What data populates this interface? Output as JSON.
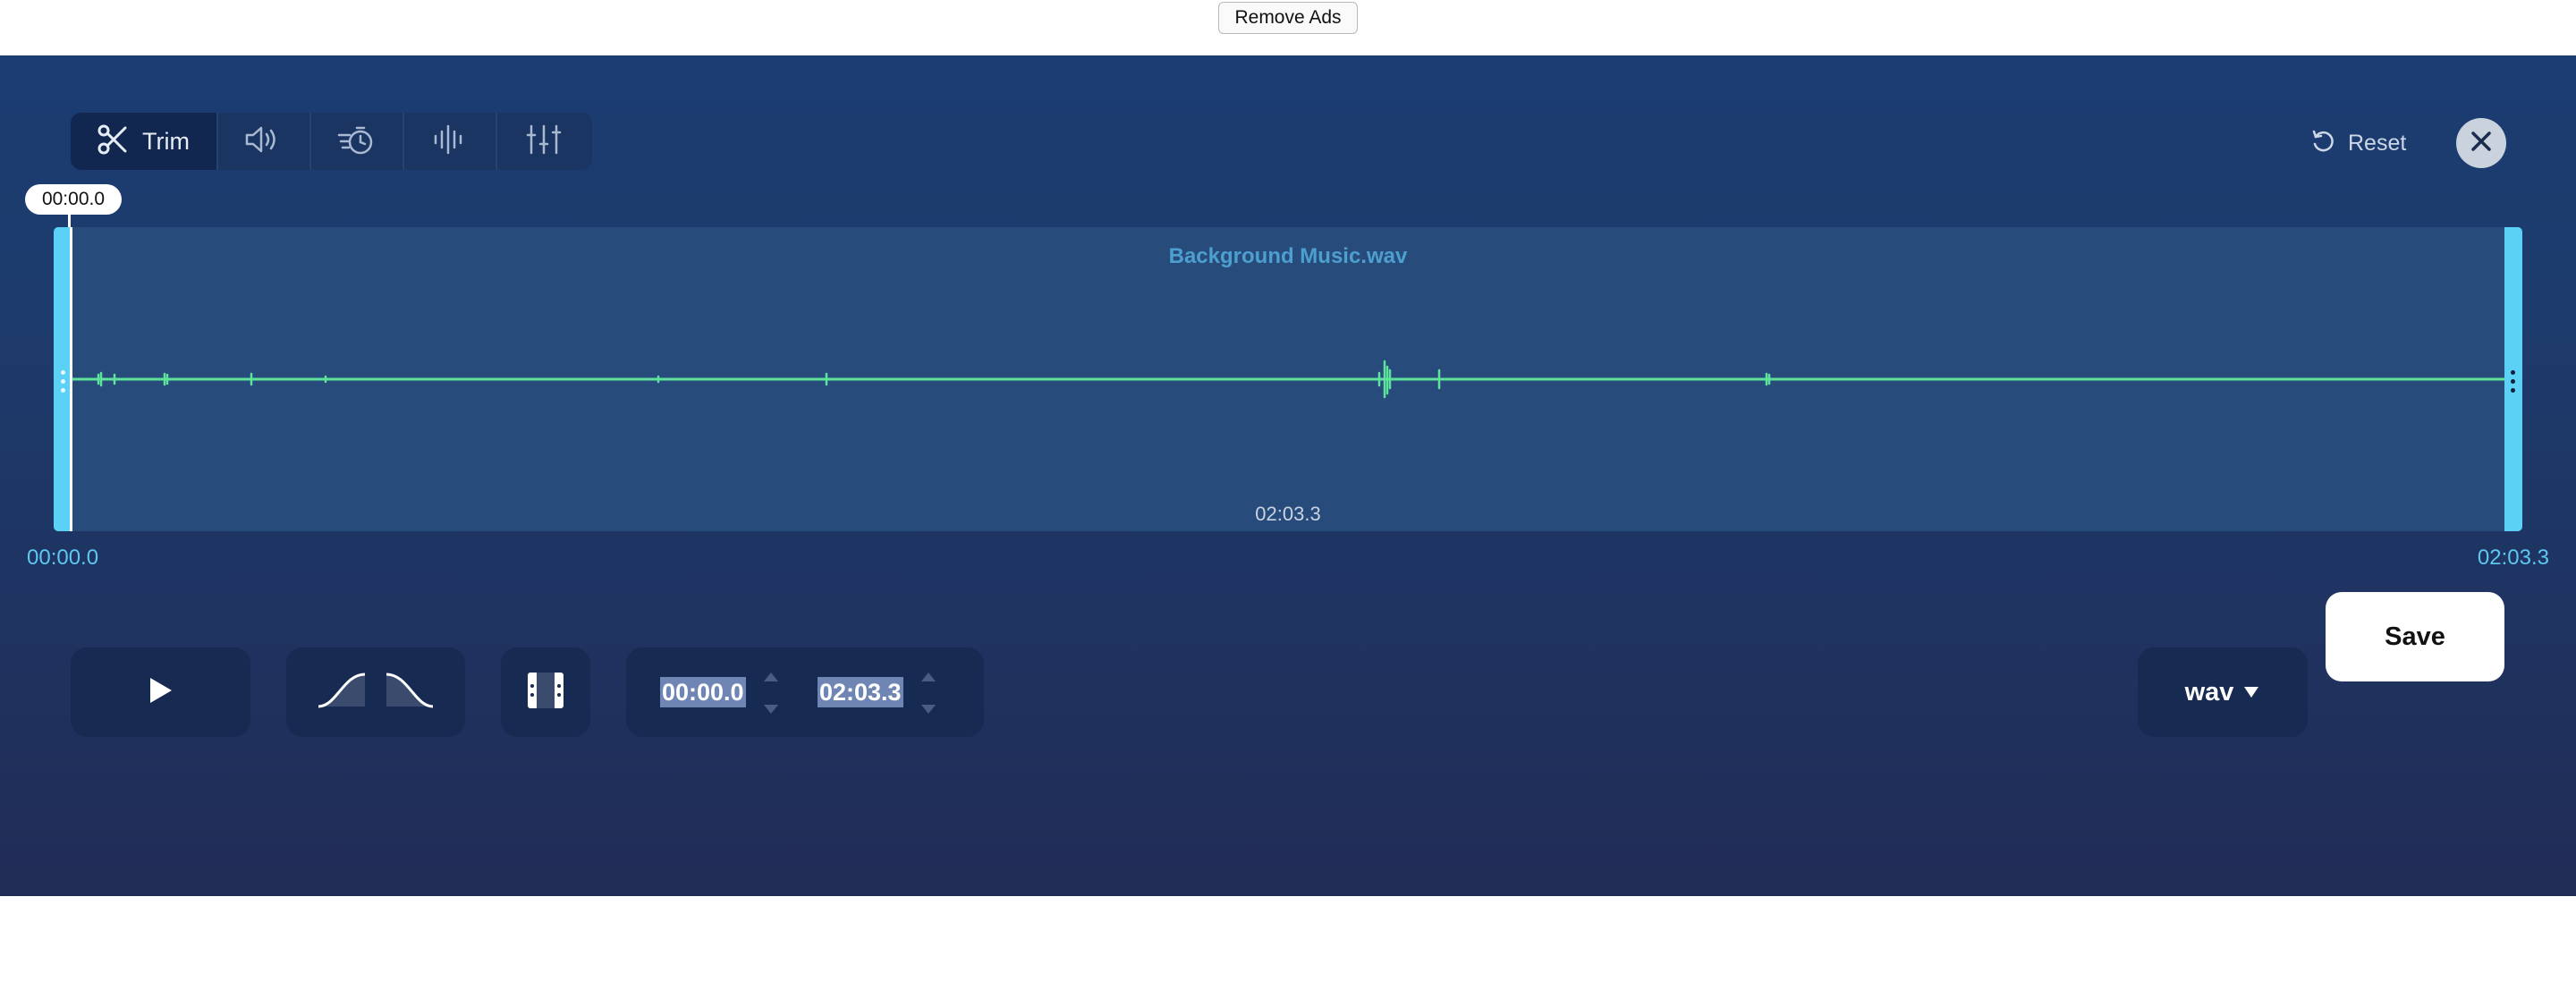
{
  "top_bar": {
    "remove_ads_label": "Remove Ads"
  },
  "toolbar": {
    "tools": [
      {
        "icon": "scissors-icon",
        "label": "Trim",
        "active": true
      },
      {
        "icon": "volume-icon",
        "label": "",
        "active": false
      },
      {
        "icon": "speed-icon",
        "label": "",
        "active": false
      },
      {
        "icon": "waveform-icon",
        "label": "",
        "active": false
      },
      {
        "icon": "equalizer-icon",
        "label": "",
        "active": false
      }
    ],
    "reset_label": "Reset"
  },
  "waveform": {
    "file_name": "Background Music.wav",
    "playhead_time": "00:00.0",
    "selection_duration": "02:03.3",
    "start_time": "00:00.0",
    "end_time": "02:03.3"
  },
  "controls": {
    "start_value": "00:00.0",
    "end_value": "02:03.3",
    "format": "wav",
    "save_label": "Save"
  },
  "colors": {
    "accent": "#5bd2f5",
    "waveform": "#5ee39a",
    "panel_top": "#1b3d72",
    "panel_bottom": "#212c56"
  }
}
